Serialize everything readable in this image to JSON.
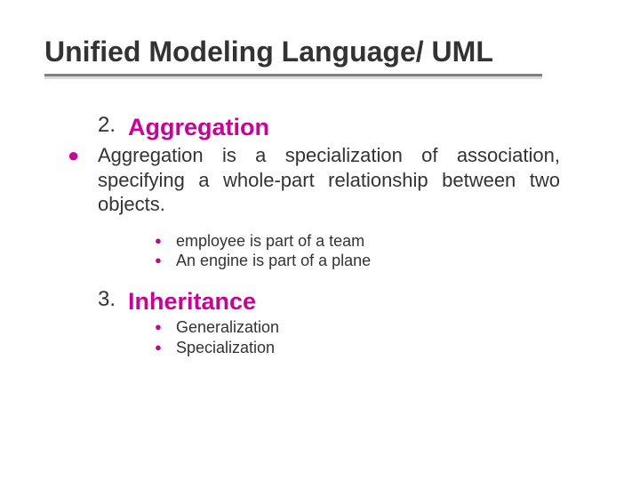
{
  "title": "Unified Modeling Language/ UML",
  "item1_num": "2.",
  "item1_heading": "Aggregation",
  "item1_desc": "Aggregation is a specialization of association, specifying a whole-part relationship between two objects.",
  "item1_sub1": "employee is part of a team",
  "item1_sub2": "An engine is part of a plane",
  "item2_num": "3.",
  "item2_heading": "Inheritance",
  "item2_sub1": "Generalization",
  "item2_sub2": "Specialization"
}
